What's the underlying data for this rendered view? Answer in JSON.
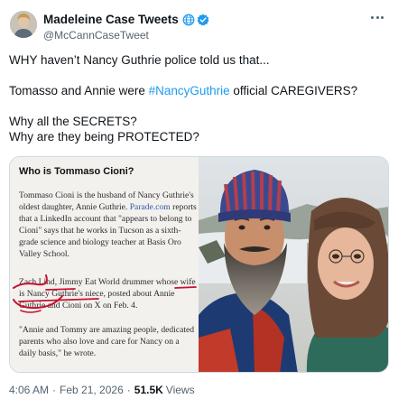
{
  "author": {
    "display_name": "Madeleine Case Tweets",
    "handle": "@McCannCaseTweet"
  },
  "tweet": {
    "line1": "WHY haven’t  Nancy Guthrie police told us that...",
    "line2_before": "Tomasso and Annie were ",
    "line2_hashtag": "#NancyGuthrie",
    "line2_after": " official CAREGIVERS?",
    "line3": "Why all the SECRETS?",
    "line4": "Why are they being PROTECTED?"
  },
  "article": {
    "title": "Who is Tommaso Cioni?",
    "p1_before": "Tommaso Cioni is the husband of Nancy Guthrie's oldest daughter, Annie Guthrie. ",
    "p1_link": "Parade.com",
    "p1_after": " reports that a LinkedIn account that \"appears to belong to Cioni\" says that he works in Tucson as a sixth-grade science and biology teacher at Basis Oro Valley School.",
    "p2": "Zach Lind, Jimmy Eat World drummer whose wife is Nancy Guthrie's niece, posted about Annie Guthrie and Cioni on X on Feb. 4.",
    "p3": "\"Annie and Tommy are amazing people, dedicated parents who also love and care for Nancy on a daily basis,\" he wrote."
  },
  "meta": {
    "time": "4:06 AM",
    "separator1": "·",
    "date": "Feb 21, 2026",
    "separator2": "·",
    "views_count": "51.5K",
    "views_label": "Views"
  },
  "colors": {
    "accent": "#1d9bf0",
    "secondary_text": "#536471",
    "annotation_red": "#c8102e"
  },
  "icons": [
    "globe-icon",
    "verified-icon",
    "more-icon"
  ]
}
